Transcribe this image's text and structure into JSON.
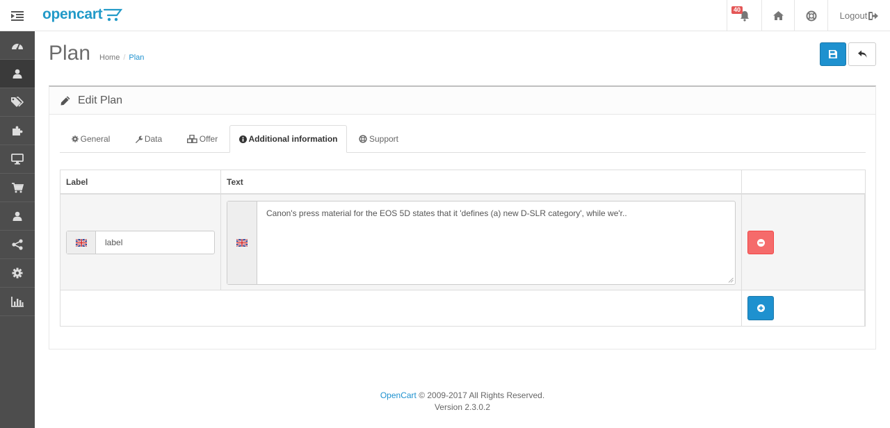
{
  "header": {
    "logo_text": "opencart",
    "notifications_count": "40",
    "logout_label": "Logout"
  },
  "sidebar": {
    "items": [
      {
        "icon": "dashboard-icon"
      },
      {
        "icon": "user-icon",
        "active": true
      },
      {
        "icon": "tags-icon"
      },
      {
        "icon": "puzzle-icon"
      },
      {
        "icon": "desktop-icon"
      },
      {
        "icon": "cart-icon"
      },
      {
        "icon": "user-icon"
      },
      {
        "icon": "share-icon"
      },
      {
        "icon": "cog-icon"
      },
      {
        "icon": "bar-chart-icon"
      }
    ]
  },
  "page": {
    "title": "Plan",
    "breadcrumb": {
      "home": "Home",
      "current": "Plan"
    }
  },
  "panel": {
    "title": "Edit Plan"
  },
  "tabs": {
    "general": "General",
    "data": "Data",
    "offer": "Offer",
    "additional": "Additional information",
    "support": "Support",
    "active": "Additional information"
  },
  "table": {
    "headers": {
      "label": "Label",
      "text": "Text",
      "actions": ""
    },
    "rows": [
      {
        "label_value": "label",
        "text_value": "Canon's press material for the EOS 5D states that it 'defines (a) new D-SLR category', while we'r.."
      }
    ]
  },
  "footer": {
    "brand_link": "OpenCart",
    "copyright": " © 2009-2017 All Rights Reserved.",
    "version": "Version 2.3.0.2"
  },
  "colors": {
    "primary": "#1e91cf",
    "danger": "#f56b6b",
    "sidebar": "#4d4d4d",
    "logo": "#229ac8"
  }
}
